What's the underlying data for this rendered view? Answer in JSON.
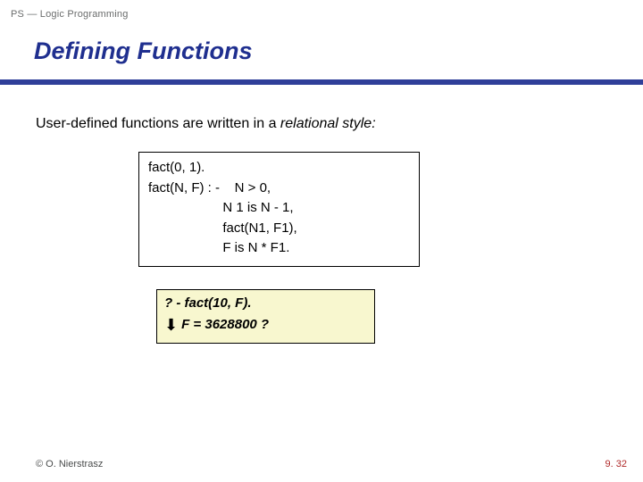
{
  "header": {
    "course": "PS — Logic Programming"
  },
  "title": "Defining Functions",
  "intro": {
    "prefix": "User-defined functions are written in a ",
    "emph": "relational style:"
  },
  "code": "fact(0, 1).\nfact(N, F) : -    N > 0,\n                    N 1 is N - 1,\n                    fact(N1, F1),\n                    F is N * F1.",
  "query": {
    "line1": "? - fact(10, F).",
    "arrow": "⬇",
    "line2": "F = 3628800 ?"
  },
  "footer": {
    "left": "© O. Nierstrasz",
    "right": "9. 32"
  }
}
